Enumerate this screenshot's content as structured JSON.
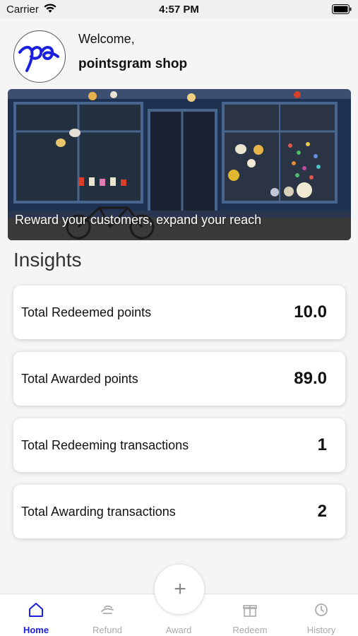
{
  "status_bar": {
    "carrier": "Carrier",
    "time": "4:57 PM"
  },
  "header": {
    "welcome": "Welcome,",
    "shop_name": "pointsgram shop",
    "avatar_icon": "pointsgram-logo-icon"
  },
  "banner": {
    "caption": "Reward your customers, expand your reach"
  },
  "insights": {
    "title": "Insights",
    "cards": [
      {
        "label": "Total Redeemed points",
        "value": "10.0"
      },
      {
        "label": "Total Awarded points",
        "value": "89.0"
      },
      {
        "label": "Total Redeeming transactions",
        "value": "1"
      },
      {
        "label": "Total Awarding transactions",
        "value": "2"
      }
    ]
  },
  "tab_bar": {
    "active_color": "#1a1fe0",
    "inactive_color": "#aaaaaa",
    "fab_symbol": "+",
    "tabs": [
      {
        "label": "Home",
        "icon": "home-icon",
        "active": true
      },
      {
        "label": "Refund",
        "icon": "refund-icon",
        "active": false
      },
      {
        "label": "Award",
        "icon": "plus-icon",
        "active": false
      },
      {
        "label": "Redeem",
        "icon": "gift-icon",
        "active": false
      },
      {
        "label": "History",
        "icon": "history-icon",
        "active": false
      }
    ]
  }
}
